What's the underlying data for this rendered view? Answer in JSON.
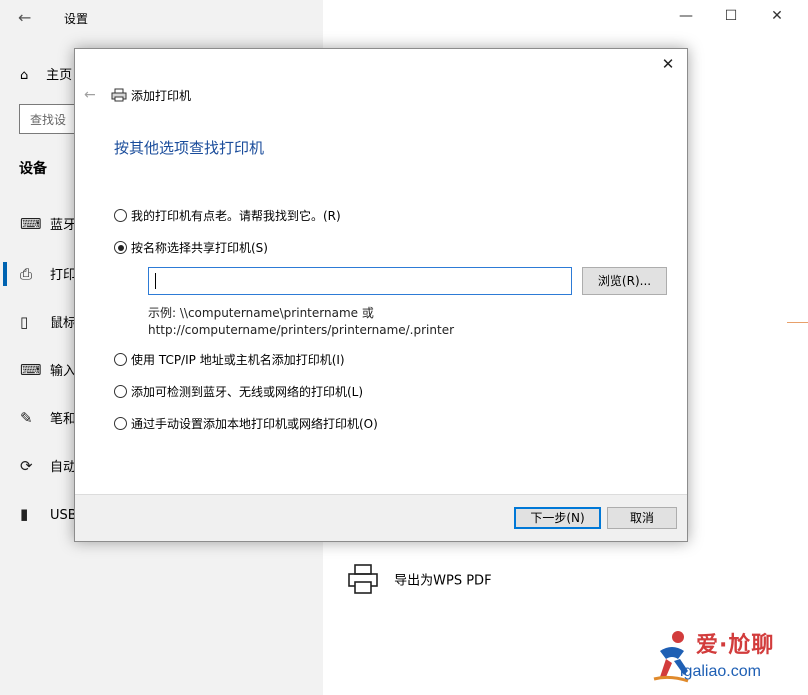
{
  "settings": {
    "title": "设置",
    "window_buttons": {
      "minimize": "—",
      "maximize": "☐",
      "close": "✕"
    },
    "home_label": "主页",
    "search_placeholder": "查找设",
    "section_heading": "设备",
    "nav_items": [
      {
        "label": "蓝牙",
        "icon": "bluetooth-icon"
      },
      {
        "label": "打印",
        "icon": "printer-icon"
      },
      {
        "label": "鼠标",
        "icon": "mouse-icon"
      },
      {
        "label": "输入",
        "icon": "keyboard-icon"
      },
      {
        "label": "笔和",
        "icon": "pen-icon"
      },
      {
        "label": "自动",
        "icon": "autoplay-icon"
      },
      {
        "label": "USB",
        "icon": "usb-icon"
      }
    ],
    "selected_index": 1,
    "printer_entry": "导出为WPS PDF",
    "accent_color": "#0063b1"
  },
  "dialog": {
    "title": "添加打印机",
    "heading": "按其他选项查找打印机",
    "options": [
      {
        "label": "我的打印机有点老。请帮我找到它。(R)",
        "checked": false
      },
      {
        "label": "按名称选择共享打印机(S)",
        "checked": true
      },
      {
        "label": "使用 TCP/IP 地址或主机名添加打印机(I)",
        "checked": false
      },
      {
        "label": "添加可检测到蓝牙、无线或网络的打印机(L)",
        "checked": false
      },
      {
        "label": "通过手动设置添加本地打印机或网络打印机(O)",
        "checked": false
      }
    ],
    "name_input_value": "",
    "browse_label": "浏览(R)...",
    "example_line1": "示例: \\\\computername\\printername 或",
    "example_line2": "http://computername/printers/printername/.printer",
    "next_label": "下一步(N)",
    "cancel_label": "取消",
    "close_glyph": "✕",
    "heading_color": "#1a4c9b"
  },
  "watermark": {
    "text_top": "爱·尬聊",
    "text_bottom": "igaliao.com"
  }
}
